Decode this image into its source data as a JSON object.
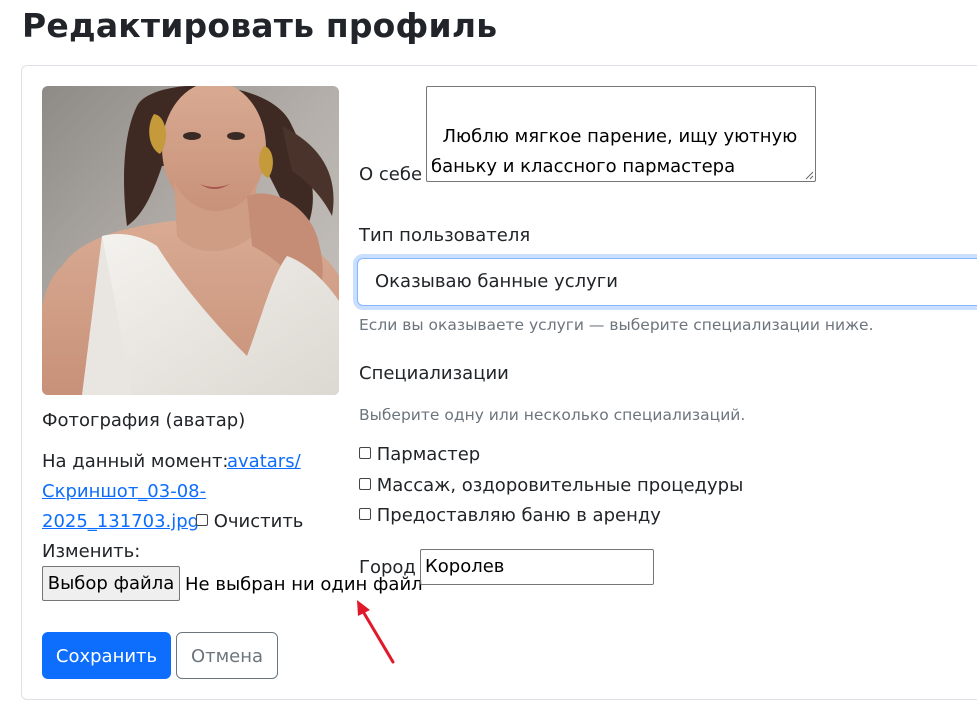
{
  "page": {
    "title": "Редактировать профиль"
  },
  "avatar": {
    "label": "Фотография (аватар)",
    "current_prefix": "На данный момент:",
    "current_link_line1": "avatars/",
    "current_link_line2": "Скриншот_03-08-",
    "current_link_line3": "2025_131703.jpg",
    "clear_label": "Очистить",
    "change_label": "Изменить:",
    "file_button": "Выбор файла",
    "file_status": "Не выбран ни один файл"
  },
  "about": {
    "label": "О себе",
    "value": "Люблю мягкое парение, ищу уютную баньку и классного пармастера"
  },
  "user_type": {
    "label": "Тип пользователя",
    "selected": "Оказываю банные услуги",
    "help": "Если вы оказываете услуги — выберите специализации ниже."
  },
  "specializations": {
    "label": "Специализации",
    "help": "Выберите одну или несколько специализаций.",
    "options": [
      {
        "label": "Пармастер",
        "checked": false
      },
      {
        "label": "Массаж, оздоровительные процедуры",
        "checked": false
      },
      {
        "label": "Предоставляю баню в аренду",
        "checked": false
      }
    ]
  },
  "city": {
    "label": "Город",
    "value": "Королев"
  },
  "actions": {
    "save": "Сохранить",
    "cancel": "Отмена"
  },
  "colors": {
    "primary": "#0d6efd",
    "secondary": "#6c757d",
    "annotation_arrow": "#e0182a"
  }
}
